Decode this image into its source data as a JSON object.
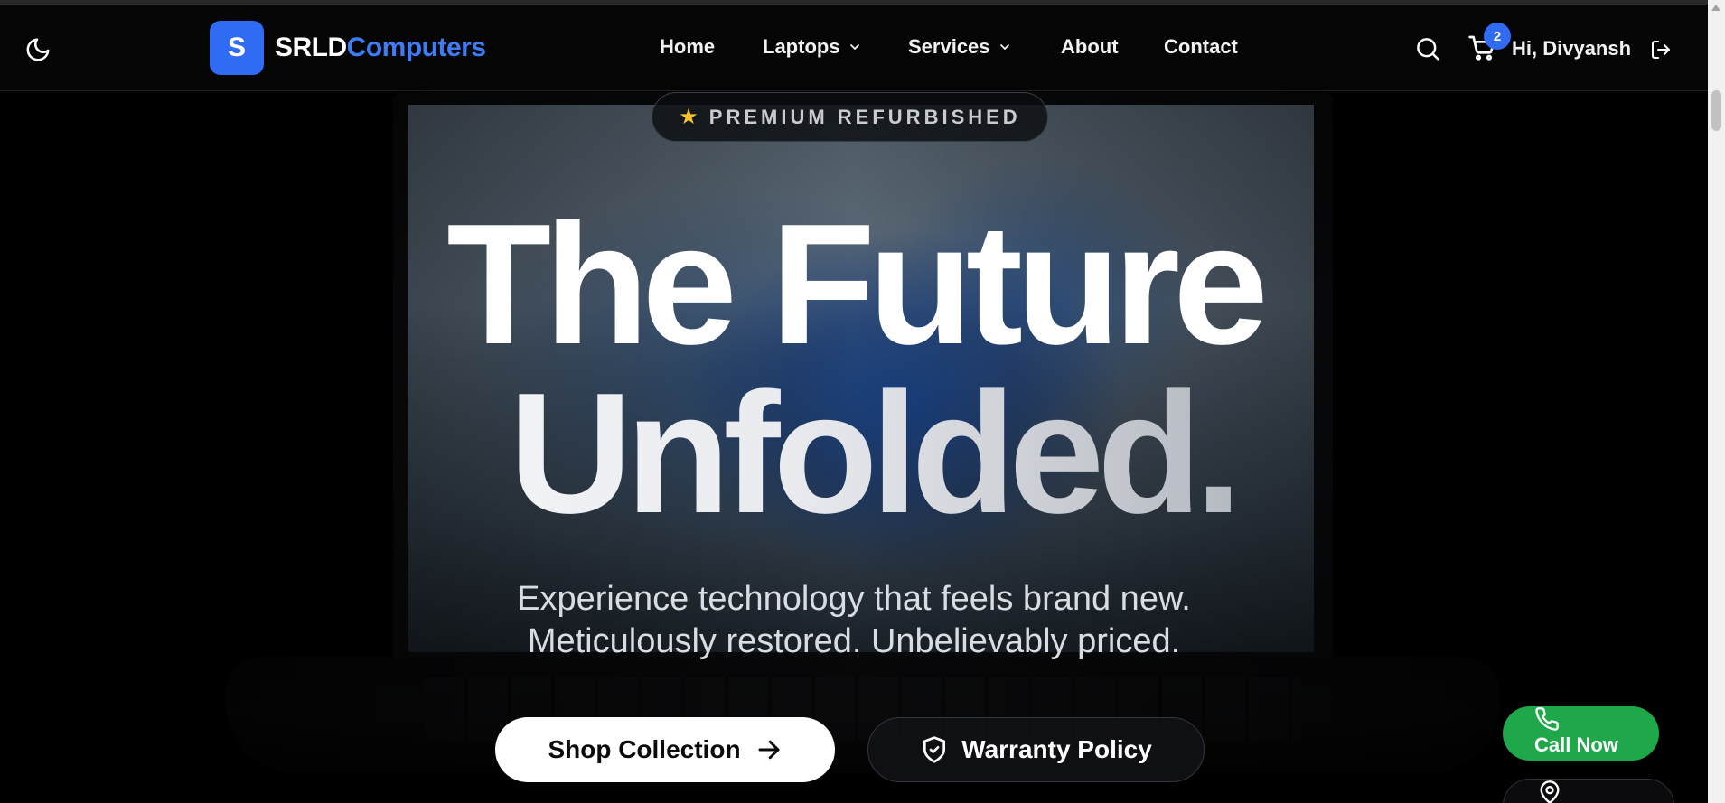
{
  "header": {
    "theme_icon": "moon-icon",
    "logo_letter": "S",
    "logo_part1": "SRLD",
    "logo_part2": "Computers",
    "nav": {
      "home": "Home",
      "laptops": "Laptops",
      "services": "Services",
      "about": "About",
      "contact": "Contact"
    },
    "cart_count": "2",
    "greeting": "Hi, Divyansh",
    "accent_color": "#2f6bf3"
  },
  "hero": {
    "badge": "PREMIUM REFURBISHED",
    "headline_line1": "The Future",
    "headline_line2": "Unfolded.",
    "subtitle_line1": "Experience technology that feels brand new.",
    "subtitle_line2": "Meticulously restored. Unbelievably priced.",
    "primary_button": "Shop Collection",
    "secondary_button": "Warranty Policy"
  },
  "floating": {
    "call_label": "Call Now",
    "call_color": "#1fa84a"
  }
}
